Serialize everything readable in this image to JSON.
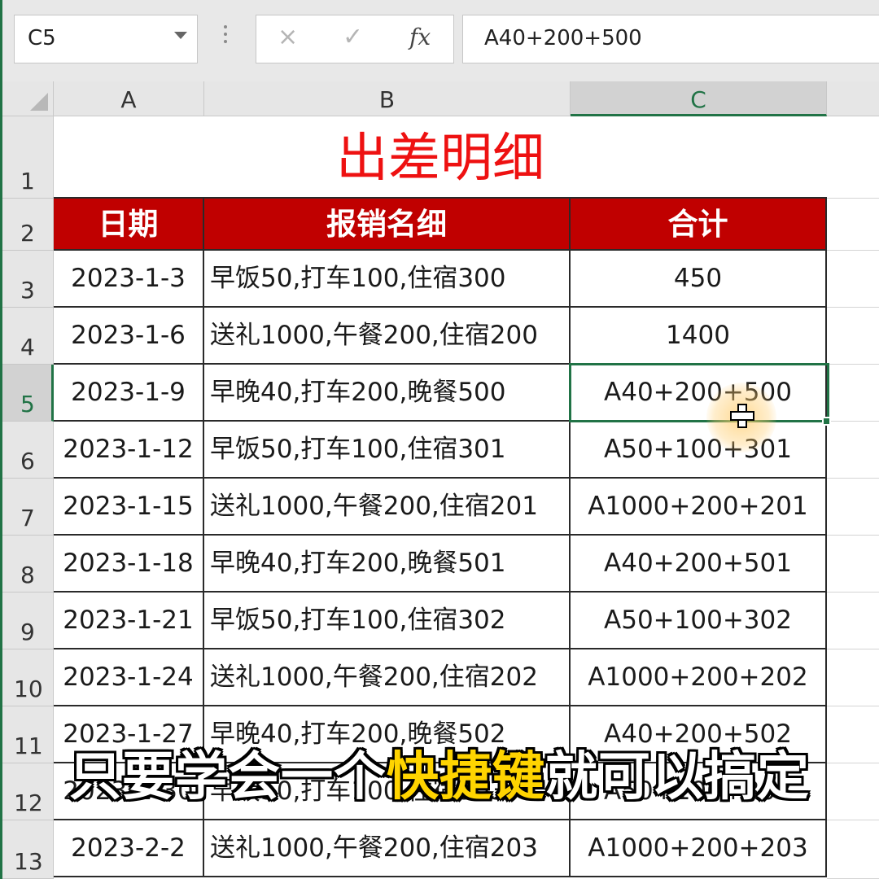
{
  "formula_bar": {
    "name_box": "C5",
    "cancel_icon": "×",
    "enter_icon": "✓",
    "fx_label": "fx",
    "formula": "A40+200+500"
  },
  "columns": [
    "A",
    "B",
    "C"
  ],
  "title": "出差明细",
  "headers": {
    "date": "日期",
    "details": "报销名细",
    "total": "合计"
  },
  "rows": [
    {
      "row": "3",
      "date": "2023-1-3",
      "details": "早饭50,打车100,住宿300",
      "total": "450"
    },
    {
      "row": "4",
      "date": "2023-1-6",
      "details": "送礼1000,午餐200,住宿200",
      "total": "1400"
    },
    {
      "row": "5",
      "date": "2023-1-9",
      "details": "早晚40,打车200,晚餐500",
      "total": "A40+200+500"
    },
    {
      "row": "6",
      "date": "2023-1-12",
      "details": "早饭50,打车100,住宿301",
      "total": "A50+100+301"
    },
    {
      "row": "7",
      "date": "2023-1-15",
      "details": "送礼1000,午餐200,住宿201",
      "total": "A1000+200+201"
    },
    {
      "row": "8",
      "date": "2023-1-18",
      "details": "早晚40,打车200,晚餐501",
      "total": "A40+200+501"
    },
    {
      "row": "9",
      "date": "2023-1-21",
      "details": "早饭50,打车100,住宿302",
      "total": "A50+100+302"
    },
    {
      "row": "10",
      "date": "2023-1-24",
      "details": "送礼1000,午餐200,住宿202",
      "total": "A1000+200+202"
    },
    {
      "row": "11",
      "date": "2023-1-27",
      "details": "早晚40,打车200,晚餐502",
      "total": "A40+200+502"
    },
    {
      "row": "12",
      "date": "2023-1-30",
      "details": "早饭50,打车100,住宿303",
      "total": "A50+100+303"
    },
    {
      "row": "13",
      "date": "2023-2-2",
      "details": "送礼1000,午餐200,住宿203",
      "total": "A1000+200+203"
    }
  ],
  "row_labels": {
    "r1": "1",
    "r2": "2"
  },
  "subtitle": {
    "before": "只要学会一个",
    "highlight": "快捷键",
    "after": "就可以搞定"
  },
  "colors": {
    "header_fill": "#c00000",
    "title_text": "#ee1111",
    "selection": "#217346",
    "subtitle_highlight": "#ffd400"
  }
}
